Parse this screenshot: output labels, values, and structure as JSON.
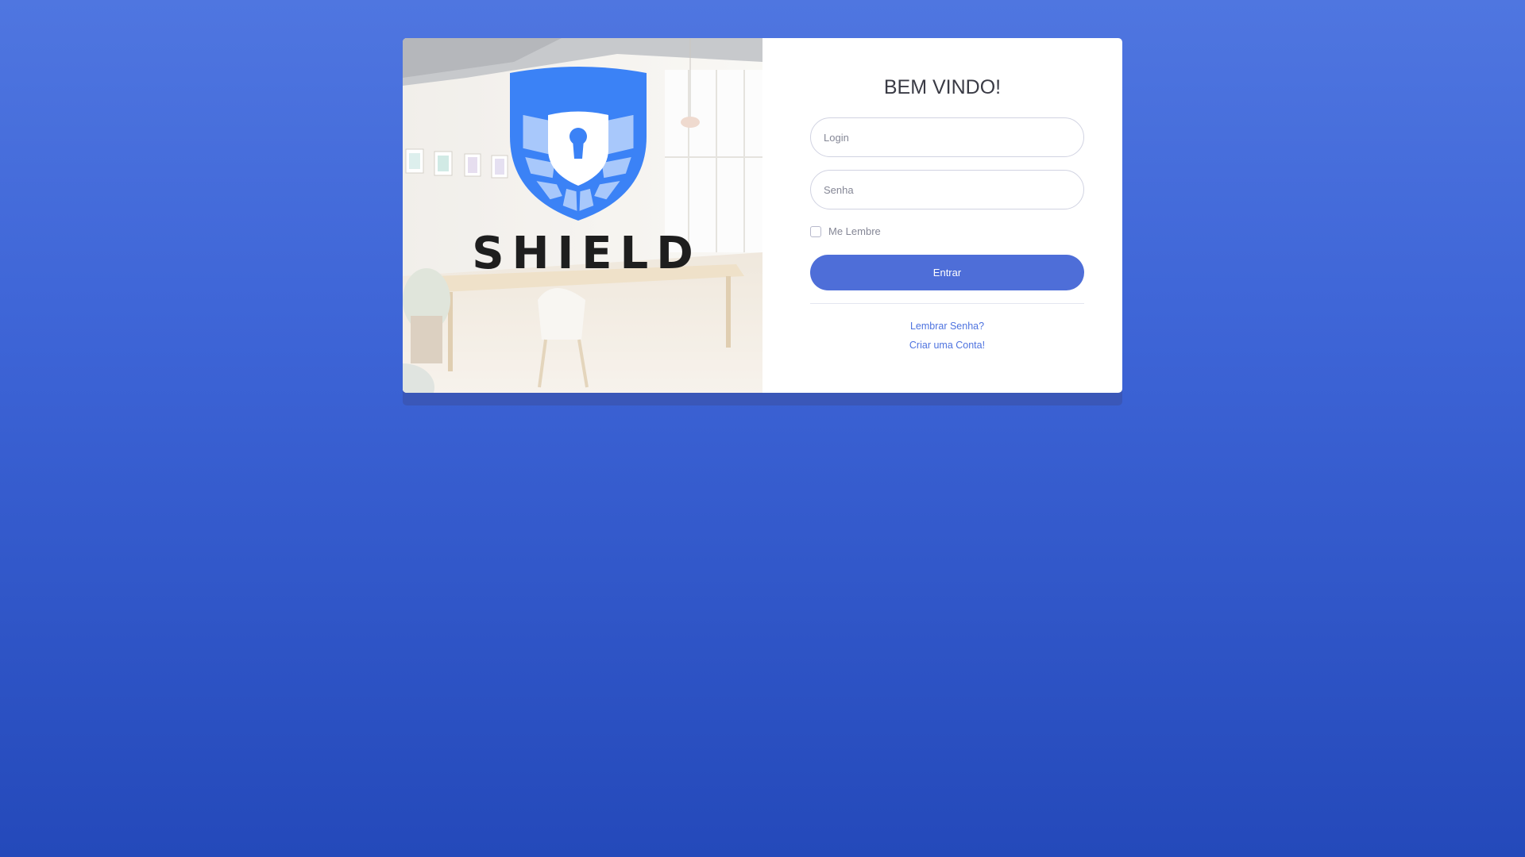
{
  "brand": {
    "name": "SHIELD",
    "shield_color": "#3b82f6"
  },
  "form": {
    "title": "BEM VINDO!",
    "login_placeholder": "Login",
    "password_placeholder": "Senha",
    "remember_label": "Me Lembre",
    "remember_checked": false,
    "submit_label": "Entrar",
    "forgot_password_link": "Lembrar Senha?",
    "create_account_link": "Criar uma Conta!"
  },
  "colors": {
    "background_top": "#4f76e0",
    "background_bottom": "#2449ba",
    "primary": "#4e6ed8",
    "link": "#4e73df",
    "title": "#3a3b45"
  },
  "icons": {
    "logo": "shield-keyhole-icon",
    "checkbox": "checkbox-icon"
  }
}
